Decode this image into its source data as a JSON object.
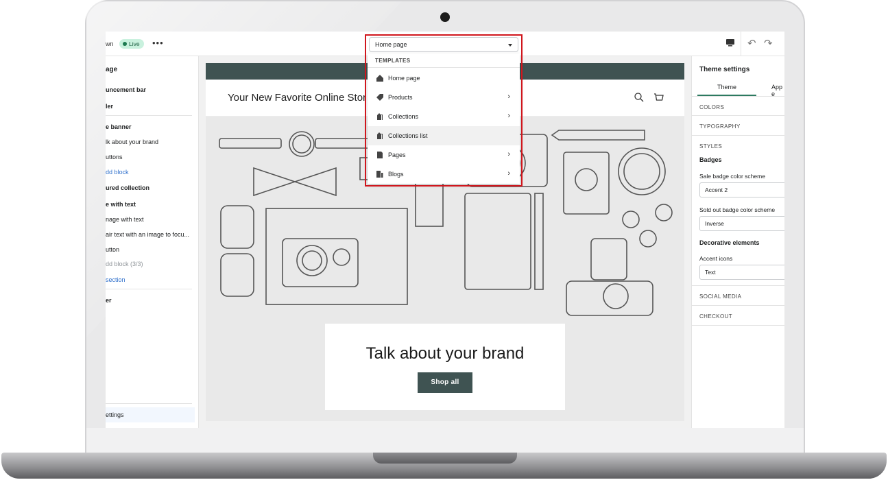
{
  "topbar": {
    "store_name": "wn",
    "live_badge": "Live",
    "more_icon": "more-horizontal-icon",
    "page_select": "Home page"
  },
  "left_panel": {
    "title": "age",
    "items": [
      {
        "label": "uncement bar"
      },
      {
        "label": "ler"
      },
      {
        "label": "e banner"
      },
      {
        "label": "lk about your brand"
      },
      {
        "label": "uttons"
      },
      {
        "label": "dd block"
      },
      {
        "label": "ured collection"
      },
      {
        "label": "e with text"
      },
      {
        "label": "nage with text"
      },
      {
        "label": "air text with an image to focu..."
      },
      {
        "label": "utton"
      },
      {
        "label": "dd block (3/3)"
      },
      {
        "label": "section"
      },
      {
        "label": "er"
      }
    ],
    "theme_settings": "ettings"
  },
  "dropdown": {
    "header": "TEMPLATES",
    "items": [
      {
        "label": "Home page",
        "icon": "home-icon",
        "has_arrow": false
      },
      {
        "label": "Products",
        "icon": "tag-icon",
        "has_arrow": true
      },
      {
        "label": "Collections",
        "icon": "collections-icon",
        "has_arrow": true
      },
      {
        "label": "Collections list",
        "icon": "collections-icon",
        "has_arrow": false
      },
      {
        "label": "Pages",
        "icon": "page-icon",
        "has_arrow": true
      },
      {
        "label": "Blogs",
        "icon": "blog-icon",
        "has_arrow": true
      }
    ]
  },
  "preview": {
    "store_title": "Your New Favorite Online Stor",
    "banner_heading": "Talk about your brand",
    "shop_button": "Shop all"
  },
  "right_panel": {
    "title": "Theme settings",
    "tabs": [
      "Theme",
      "App e"
    ],
    "sections": {
      "colors": "COLORS",
      "typography": "TYPOGRAPHY",
      "styles": "STYLES",
      "social": "SOCIAL MEDIA",
      "checkout": "CHECKOUT"
    },
    "badges": "Badges",
    "sale_badge_label": "Sale badge color scheme",
    "sale_badge_value": "Accent 2",
    "sold_out_label": "Sold out badge color scheme",
    "sold_out_value": "Inverse",
    "decorative": "Decorative elements",
    "accent_icons_label": "Accent icons",
    "accent_icons_value": "Text"
  },
  "colors": {
    "accent": "#3f5352",
    "highlight": "#d0161d",
    "live_badge_bg": "#c9f1de"
  }
}
